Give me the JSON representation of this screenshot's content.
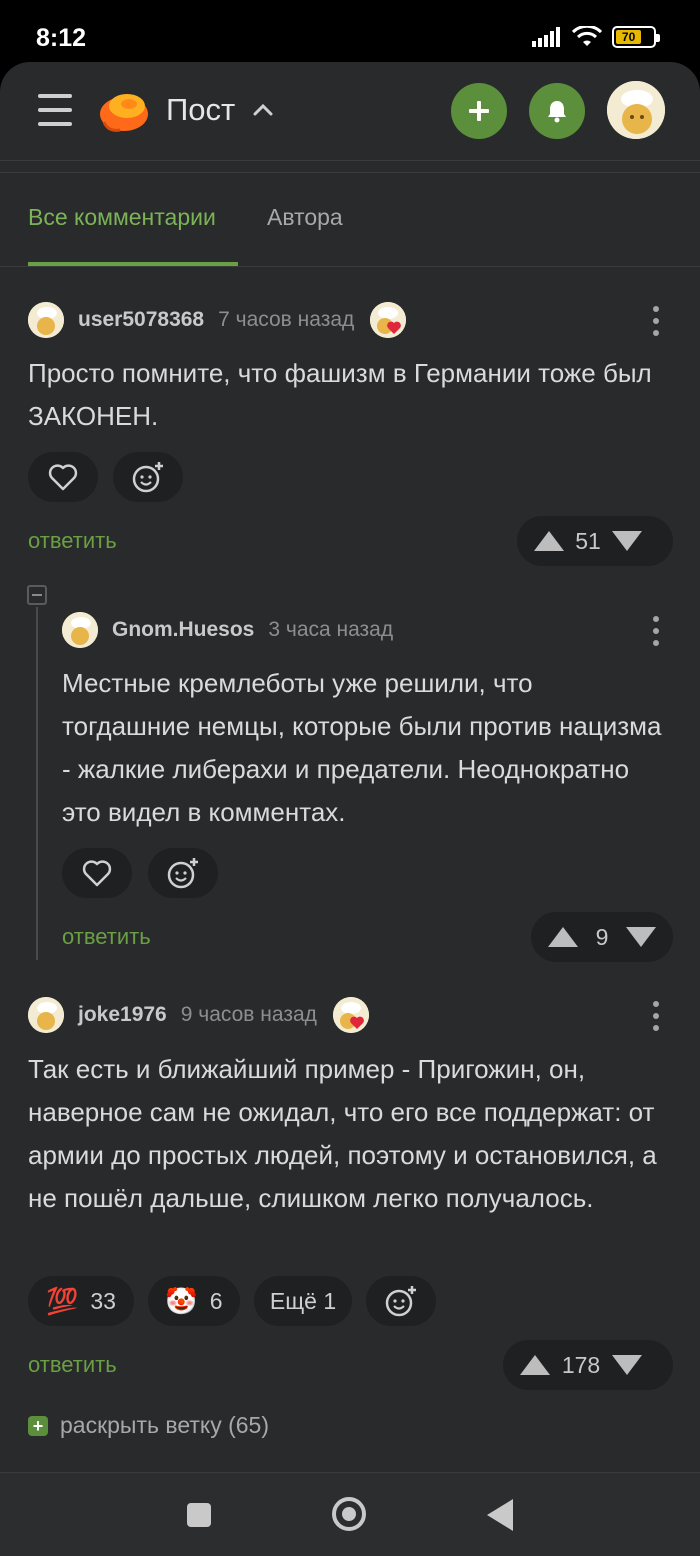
{
  "status_bar": {
    "time": "8:12",
    "battery": "70"
  },
  "header": {
    "title": "Пост"
  },
  "tabs": [
    {
      "label": "Все комментарии"
    },
    {
      "label": "Автора"
    }
  ],
  "comments": [
    {
      "user": "user5078368",
      "time": "7 часов назад",
      "text": "Просто помните, что фашизм в Германии тоже был ЗАКОНЕН.",
      "reply_label": "ответить",
      "rating": "51"
    },
    {
      "user": "Gnom.Huesos",
      "time": "3 часа назад",
      "text": "Местные кремлеботы уже решили, что тогдашние немцы, которые были против нацизма - жалкие либерахи и предатели. Неоднократно это видел в комментах.",
      "reply_label": "ответить",
      "rating": "9"
    },
    {
      "user": "joke1976",
      "time": "9 часов назад",
      "text": "Так есть и ближайший пример - Пригожин, он, наверное сам не ожидал, что его все поддержат: от армии до простых людей, поэтому и остановился, а не пошёл дальше, слишком легко получалось.",
      "reply_label": "ответить",
      "rating": "178",
      "reactions": [
        {
          "emoji": "💯",
          "count": "33"
        },
        {
          "emoji": "🤡",
          "count": "6"
        }
      ],
      "more_reactions": "Ещё 1"
    }
  ],
  "expand_thread": "раскрыть ветку (65)",
  "colors": {
    "accent": "#6a9f44",
    "background": "#292a2c",
    "pill": "#1f2022"
  }
}
